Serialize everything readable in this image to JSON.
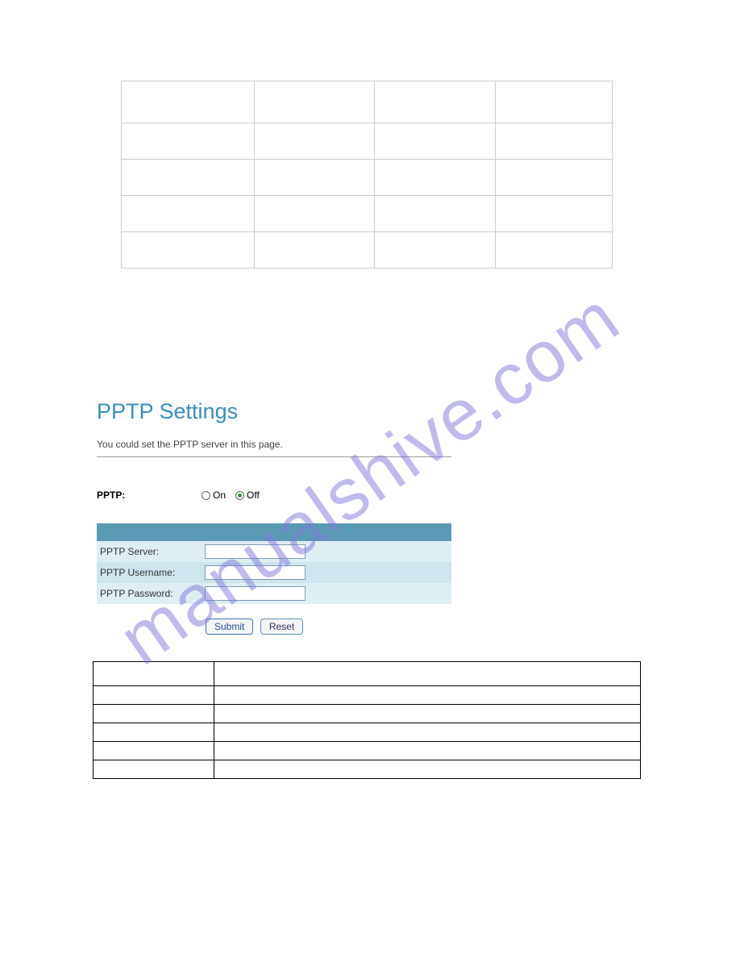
{
  "watermark_text": "manualshive.com",
  "settings": {
    "title": "PPTP Settings",
    "description": "You could set the PPTP server in this page.",
    "pptp_label": "PPTP:",
    "radio_on": "On",
    "radio_off": "Off",
    "radio_selected": "off",
    "fields": {
      "server_label": "PPTP Server:",
      "server_value": "",
      "username_label": "PPTP Username:",
      "username_value": "",
      "password_label": "PPTP Password:",
      "password_value": ""
    },
    "submit_label": "Submit",
    "reset_label": "Reset"
  }
}
